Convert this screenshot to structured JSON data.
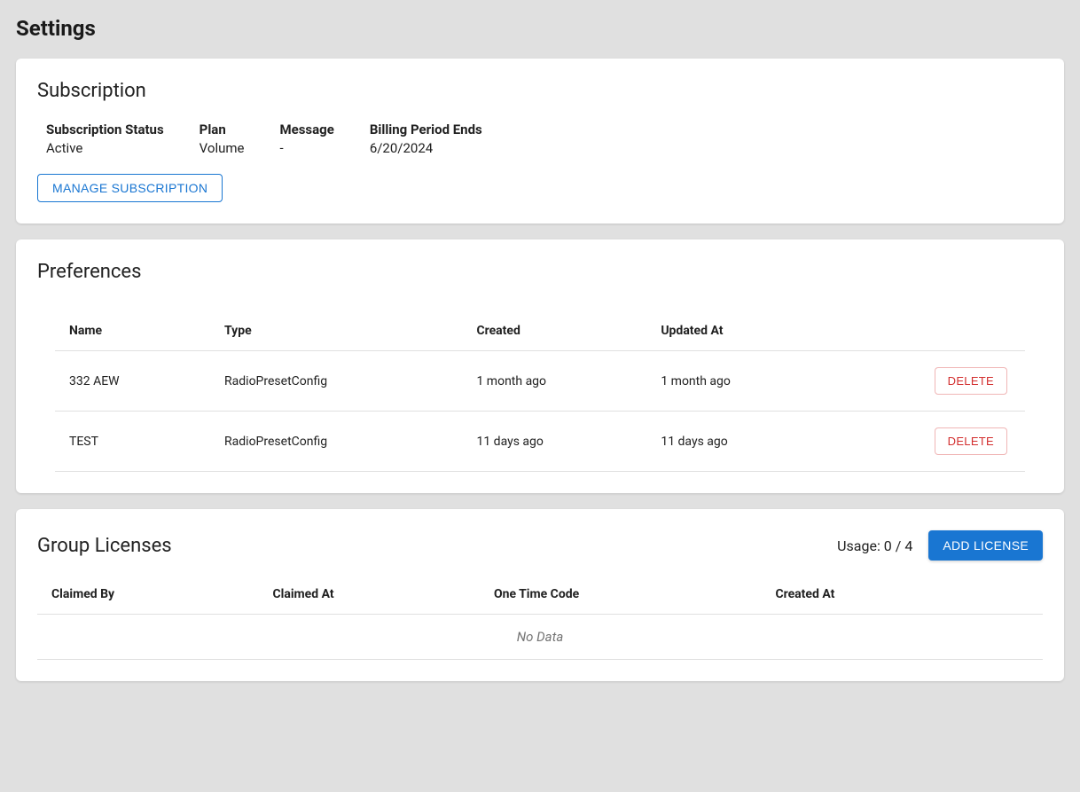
{
  "page": {
    "title": "Settings"
  },
  "subscription": {
    "card_title": "Subscription",
    "fields": {
      "status_label": "Subscription Status",
      "status_value": "Active",
      "plan_label": "Plan",
      "plan_value": "Volume",
      "message_label": "Message",
      "message_value": "-",
      "billing_label": "Billing Period Ends",
      "billing_value": "6/20/2024"
    },
    "manage_button": "Manage Subscription"
  },
  "preferences": {
    "card_title": "Preferences",
    "columns": {
      "name": "Name",
      "type": "Type",
      "created": "Created",
      "updated": "Updated At"
    },
    "rows": [
      {
        "name": "332 AEW",
        "type": "RadioPresetConfig",
        "created": "1 month ago",
        "updated": "1 month ago",
        "delete_label": "Delete"
      },
      {
        "name": "TEST",
        "type": "RadioPresetConfig",
        "created": "11 days ago",
        "updated": "11 days ago",
        "delete_label": "Delete"
      }
    ]
  },
  "licenses": {
    "card_title": "Group Licenses",
    "usage_label": "Usage: 0 / 4",
    "add_button": "Add License",
    "columns": {
      "claimed_by": "Claimed By",
      "claimed_at": "Claimed At",
      "one_time_code": "One Time Code",
      "created_at": "Created At"
    },
    "no_data": "No Data"
  }
}
